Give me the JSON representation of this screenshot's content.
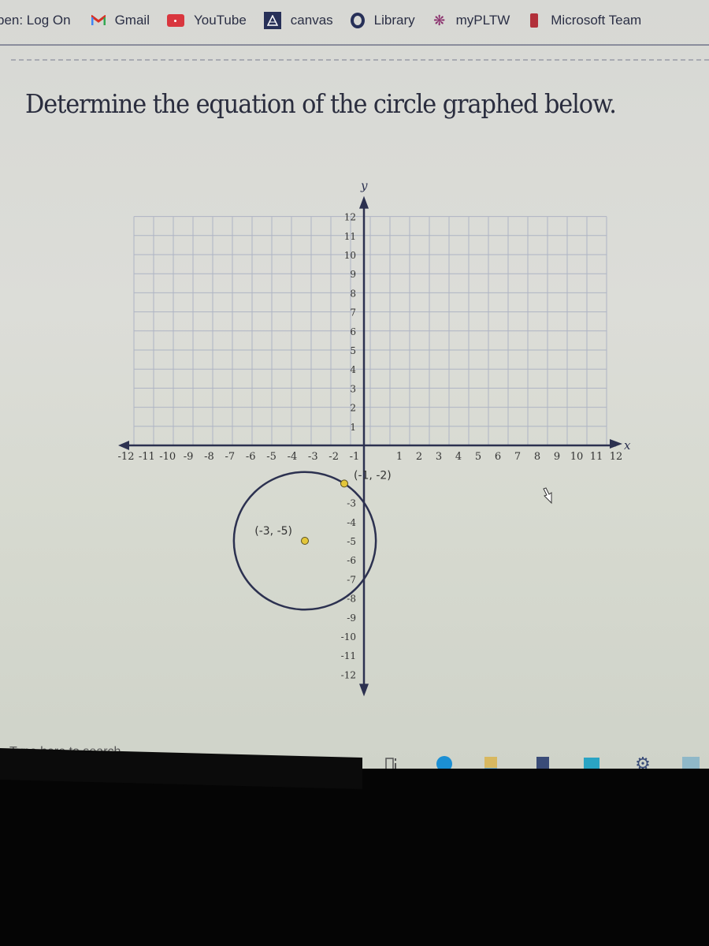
{
  "bookmarks": [
    {
      "label": "pen: Log On",
      "icon": "none"
    },
    {
      "label": "Gmail",
      "icon": "gmail-icon"
    },
    {
      "label": "YouTube",
      "icon": "youtube-icon"
    },
    {
      "label": "canvas",
      "icon": "canvas-icon"
    },
    {
      "label": "Library",
      "icon": "library-ring-icon"
    },
    {
      "label": "myPLTW",
      "icon": "pltw-atom-icon"
    },
    {
      "label": "Microsoft Team",
      "icon": "office-icon"
    }
  ],
  "question": "Determine the equation of the circle graphed below.",
  "chart_data": {
    "type": "scatter",
    "title": "",
    "xlabel": "x",
    "ylabel": "y",
    "xlim": [
      -12,
      12
    ],
    "ylim": [
      -12,
      12
    ],
    "grid": true,
    "x_ticks": [
      -12,
      -11,
      -10,
      -9,
      -8,
      -7,
      -6,
      -5,
      -4,
      -3,
      -2,
      -1,
      1,
      2,
      3,
      4,
      5,
      6,
      7,
      8,
      9,
      10,
      11,
      12
    ],
    "y_ticks": [
      12,
      11,
      10,
      9,
      8,
      7,
      6,
      5,
      4,
      3,
      2,
      1,
      -3,
      -4,
      -5,
      -6,
      -7,
      -8,
      -9,
      -10,
      -11,
      -12
    ],
    "circle": {
      "center": [
        -3,
        -5
      ],
      "through": [
        -1,
        -2
      ],
      "radius_squared": 13
    },
    "points": [
      {
        "x": -3,
        "y": -5,
        "label": "(-3, -5)"
      },
      {
        "x": -1,
        "y": -2,
        "label": "(-1, -2)"
      }
    ]
  },
  "colors": {
    "axis": "#2c3150",
    "grid": "#aeb4c4",
    "point": "#e3c63a",
    "circle": "#2c3150"
  },
  "taskbar": {
    "search_placeholder": "Type here to search",
    "icons": [
      "cortana-icon",
      "task-view-icon",
      "edge-icon",
      "file-explorer-icon",
      "store-icon",
      "mail-icon",
      "settings-icon",
      "photos-icon"
    ]
  }
}
